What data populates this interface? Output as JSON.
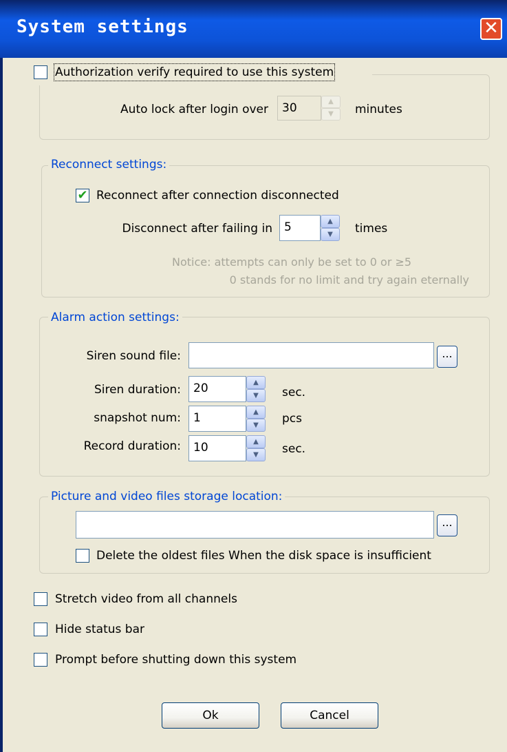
{
  "window": {
    "title": "System settings"
  },
  "authorization": {
    "checkbox_label": "Authorization verify required to use this system",
    "checked": false,
    "auto_lock_label": "Auto lock after login over",
    "auto_lock_value": "30",
    "auto_lock_unit": "minutes"
  },
  "reconnect": {
    "legend": "Reconnect settings:",
    "checkbox_label": "Reconnect after connection disconnected",
    "checked": true,
    "disconnect_label": "Disconnect after failing in",
    "disconnect_value": "5",
    "disconnect_unit": "times",
    "notice_line1": "Notice: attempts can only be set to 0 or ≥5",
    "notice_line2": "0 stands for no limit and try again eternally"
  },
  "alarm": {
    "legend": "Alarm action settings:",
    "siren_file_label": "Siren sound file:",
    "siren_file_value": "",
    "browse_label": "...",
    "siren_duration_label": "Siren duration:",
    "siren_duration_value": "20",
    "siren_duration_unit": "sec.",
    "snapshot_label": "snapshot num:",
    "snapshot_value": "1",
    "snapshot_unit": "pcs",
    "record_label": "Record duration:",
    "record_value": "10",
    "record_unit": "sec."
  },
  "storage": {
    "legend": "Picture and video files storage location:",
    "path_value": "",
    "browse_label": "...",
    "delete_oldest_label": "Delete the oldest files When the disk space is insufficient",
    "delete_oldest_checked": false
  },
  "options": {
    "stretch_label": "Stretch video from all channels",
    "hide_status_label": "Hide status bar",
    "prompt_shutdown_label": "Prompt before shutting down this system"
  },
  "buttons": {
    "ok": "Ok",
    "cancel": "Cancel"
  },
  "icons": {
    "close": "close-icon",
    "check": "check-icon",
    "spin_up": "up-arrow-icon",
    "spin_down": "down-arrow-icon"
  },
  "colors": {
    "titlebar": "#0D53D8",
    "dialog_bg": "#ECE9D8",
    "legend_text": "#0046D5",
    "close_button": "#E24B2A",
    "check_mark": "#21A121",
    "notice_text": "#A7A69A"
  }
}
